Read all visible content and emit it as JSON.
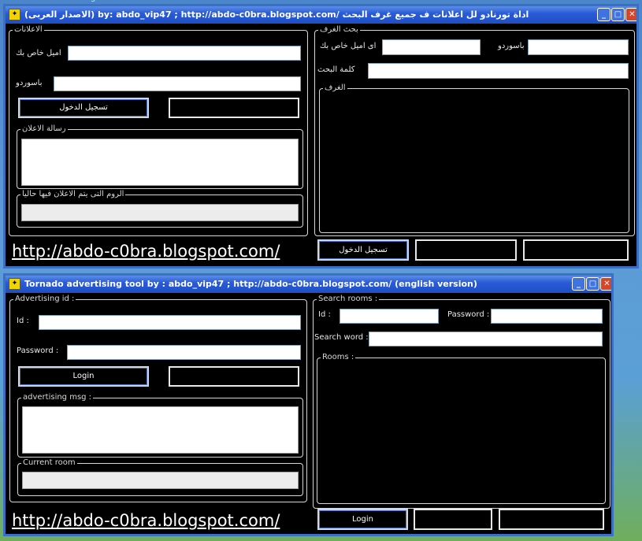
{
  "window_ar": {
    "title": "(الاصدار العربى) by: abdo_vip47 ; http://abdo-c0bra.blogspot.com/ اداة تورنادو لل اعلانات ف جميع غرف البحث",
    "left_group": "الاعلانات",
    "email_label": "اميل خاص بك",
    "password_label": "باسوردو",
    "login_button": "تسجيل الدخول",
    "msg_group": "رسالة الاعلان",
    "current_room_group": "الروم التى يتم الاعلان فيها حاليا",
    "search_group": "بحث الغرف",
    "search_email_label": "اى اميل خاص بك",
    "search_password_label": "باسوردو",
    "search_word_label": "كلمة البحث",
    "rooms_group": "الغرف",
    "rooms_login_button": "تسجيل الدخول",
    "link": "http://abdo-c0bra.blogspot.com/"
  },
  "window_en": {
    "title": "Tornado advertising tool by : abdo_vip47 ; http://abdo-c0bra.blogspot.com/ (english version)",
    "left_group": "Advertising id :",
    "id_label": "Id :",
    "password_label": "Password :",
    "login_button": "Login",
    "msg_group": "advertising msg :",
    "current_room_group": "Current room",
    "search_group": "Search rooms :",
    "search_id_label": "Id :",
    "search_password_label": "Password :",
    "search_word_label": "Search word :",
    "rooms_group": "Rooms :",
    "rooms_login_button": "Login",
    "link": "http://abdo-c0bra.blogspot.com/"
  },
  "taskbar_stub": "login"
}
